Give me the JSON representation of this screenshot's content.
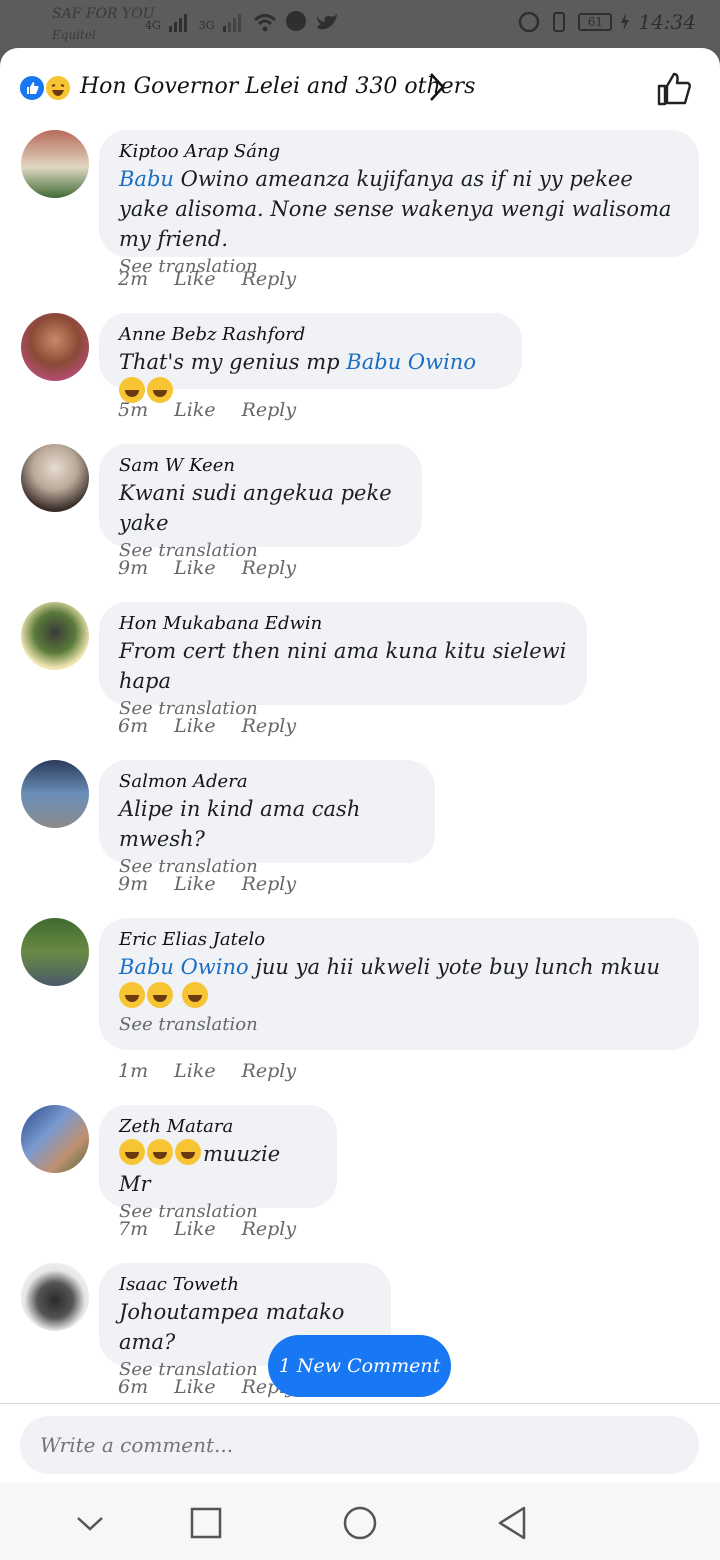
{
  "status_bar": {
    "carrier": "SAF FOR YOU",
    "carrier_sub": "Equitel",
    "network1": "4G",
    "network2": "3G",
    "battery": "61",
    "time": "14:34"
  },
  "header": {
    "title": "Hon Governor Lelei and 330 others"
  },
  "comments": [
    {
      "author": "Kiptoo Arap Sáng",
      "mention": "Babu",
      "text": " Owino ameanza kujifanya as if ni yy pekee yake alisoma. None sense wakenya wengi walisoma my friend.",
      "translate": "See translation",
      "time": "2m",
      "like": "Like",
      "reply": "Reply"
    },
    {
      "author": "Anne Bebz Rashford",
      "text": "That's my genius mp ",
      "mention": "Babu Owino",
      "translate": "",
      "time": "5m",
      "like": "Like",
      "reply": "Reply"
    },
    {
      "author": "Sam W Keen",
      "text": "Kwani sudi angekua peke yake",
      "translate": "See translation",
      "time": "9m",
      "like": "Like",
      "reply": "Reply"
    },
    {
      "author": "Hon Mukabana Edwin",
      "text": "From cert then nini ama kuna kitu sielewi hapa",
      "translate": "See translation",
      "time": "6m",
      "like": "Like",
      "reply": "Reply"
    },
    {
      "author": "Salmon Adera",
      "text": "Alipe in kind ama cash mwesh?",
      "translate": "See translation",
      "time": "9m",
      "like": "Like",
      "reply": "Reply"
    },
    {
      "author": "Eric Elias Jatelo",
      "mention": "Babu Owino",
      "text": "  juu ya hii ukweli yote buy lunch mkuu ",
      "translate": "See translation",
      "time": "1m",
      "like": "Like",
      "reply": "Reply"
    },
    {
      "author": "Zeth Matara",
      "text": "muuzie Mr",
      "translate": "See translation",
      "time": "7m",
      "like": "Like",
      "reply": "Reply"
    },
    {
      "author": "Isaac Toweth",
      "text": "Johoutampea matako ama?",
      "translate": "See translation",
      "time": "6m",
      "like": "Like",
      "reply": "Reply"
    }
  ],
  "new_comment": "1 New Comment",
  "composer": {
    "placeholder": "Write a comment..."
  },
  "colors": {
    "accent": "#1877f2",
    "mention": "#1a6ec5",
    "bubble": "#f0f2f5"
  }
}
